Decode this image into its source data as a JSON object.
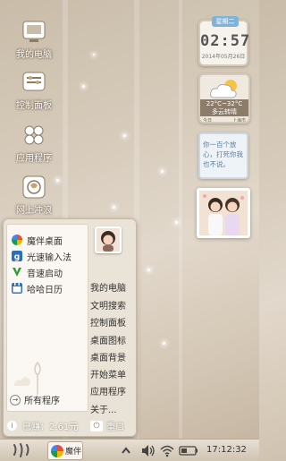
{
  "desktop": {
    "icons": [
      {
        "label": "我的电脑",
        "icon": "computer-icon"
      },
      {
        "label": "控制面板",
        "icon": "control-panel-icon"
      },
      {
        "label": "应用程序",
        "icon": "applications-icon"
      },
      {
        "label": "网上冲浪",
        "icon": "internet-icon"
      }
    ]
  },
  "widgets": {
    "clock": {
      "day": "星期二",
      "time": "02:57",
      "date": "2014年05月26日"
    },
    "weather": {
      "temp": "22°C~32°C",
      "condition": "多云转晴",
      "day_label": "今日",
      "city": "上海市"
    },
    "note": {
      "text": "你一百个放心，打死你我也不说。"
    }
  },
  "start_menu": {
    "apps": [
      {
        "label": "魔伴桌面",
        "icon": "pinwheel-icon"
      },
      {
        "label": "光速输入法",
        "icon": "input-method-icon"
      },
      {
        "label": "音速启动",
        "icon": "launcher-icon"
      },
      {
        "label": "哈哈日历",
        "icon": "calendar-icon"
      }
    ],
    "all_programs": "所有程序",
    "right_links": [
      "我的电脑",
      "文明搜索",
      "控制面板",
      "桌面图标",
      "桌面背景",
      "开始菜单",
      "应用程序",
      "关于..."
    ],
    "earned": "已赚：2.61元",
    "restart": "重启"
  },
  "taskbar": {
    "task_label": "魔伴",
    "time": "17:12:32"
  },
  "colors": {
    "accent": "#7fb4d8",
    "menu_bg": "#ebe4d8",
    "taskbar": "#d8cdbd"
  }
}
